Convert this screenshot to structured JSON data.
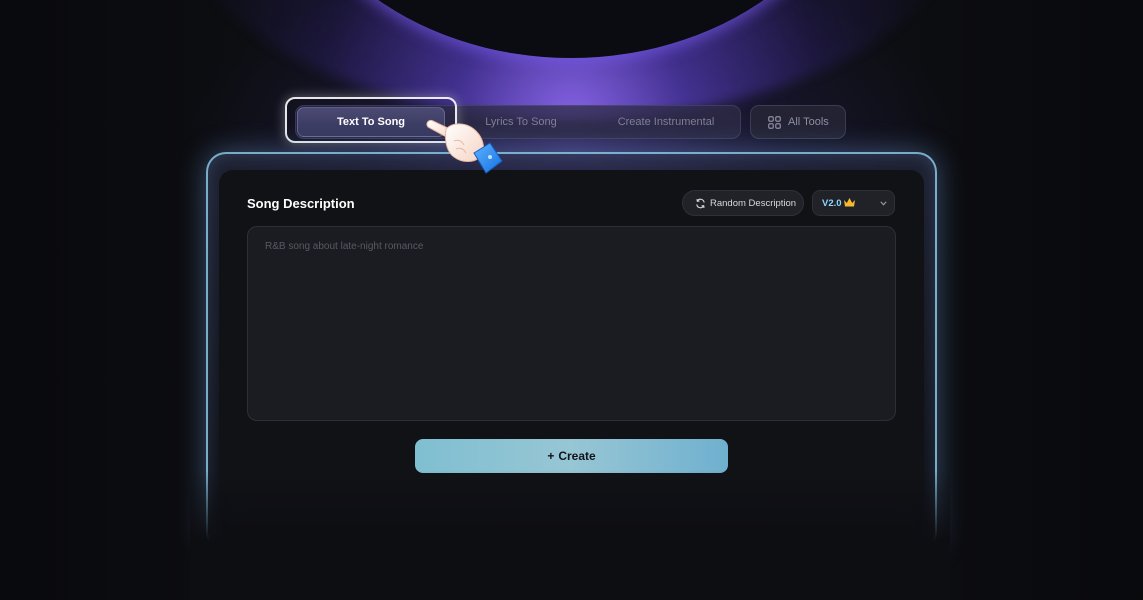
{
  "tabs": {
    "items": [
      {
        "label": "Text To Song",
        "active": true
      },
      {
        "label": "Lyrics To Song",
        "active": false
      },
      {
        "label": "Create Instrumental",
        "active": false
      }
    ],
    "all_tools_label": "All Tools",
    "all_tools_icon": "grid-icon"
  },
  "panel": {
    "title": "Song Description",
    "random_button_label": "Random Description",
    "random_button_icon": "refresh-icon",
    "version": {
      "selected": "V2.0",
      "badge_icon": "crown-icon",
      "badge_color": "#f5b82e",
      "chevron_icon": "chevron-down-icon"
    },
    "description": {
      "placeholder": "R&B song about late-night romance",
      "value": ""
    },
    "create_label": "Create",
    "create_icon": "sparkle-icon"
  },
  "colors": {
    "background": "#0d0e12",
    "panel_border": "#8cc8e6",
    "accent_glow": "#7a5cf0",
    "create_button": "#8fc3d3",
    "version_text": "#8fd3ff"
  },
  "cursor": {
    "icon": "pointing-hand-icon"
  }
}
